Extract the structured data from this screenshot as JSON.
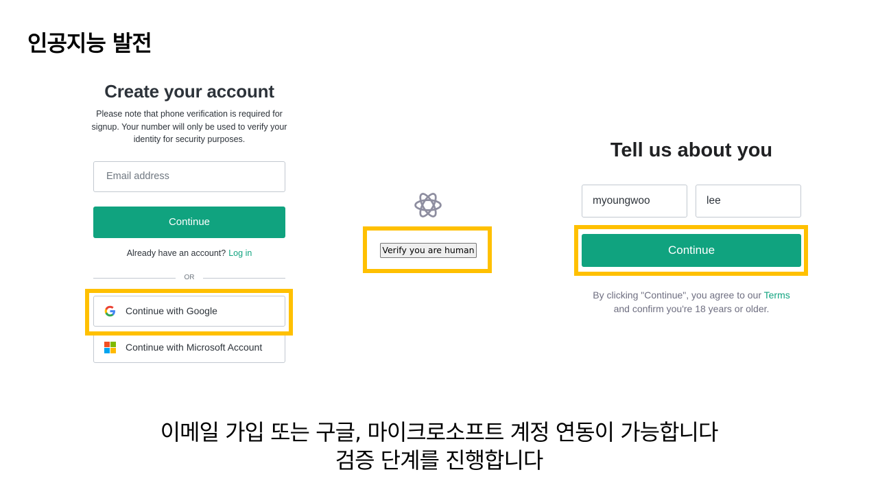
{
  "slide": {
    "title": "인공지능 발전",
    "caption_line1": "이메일 가입 또는 구글, 마이크로소프트 계정 연동이 가능합니다",
    "caption_line2": "검증 단계를 진행합니다",
    "highlight_color": "#ffc000"
  },
  "signup": {
    "title": "Create your account",
    "note": "Please note that phone verification is required for signup. Your number will only be used to verify your identity for security purposes.",
    "email_placeholder": "Email address",
    "continue_label": "Continue",
    "already_text": "Already have an account?",
    "login_link": "Log in",
    "or_text": "OR",
    "google_label": "Continue with Google",
    "microsoft_label": "Continue with Microsoft Account",
    "accent_color": "#10a37f"
  },
  "verify": {
    "logo_icon": "openai-logo-icon",
    "button_label": "Verify you are human"
  },
  "about": {
    "title": "Tell us about you",
    "first_name": "myoungwoo",
    "last_name": "lee",
    "continue_label": "Continue",
    "terms_prefix": "By clicking \"Continue\", you agree to our ",
    "terms_link": "Terms",
    "terms_suffix": "and confirm you're 18 years or older."
  }
}
